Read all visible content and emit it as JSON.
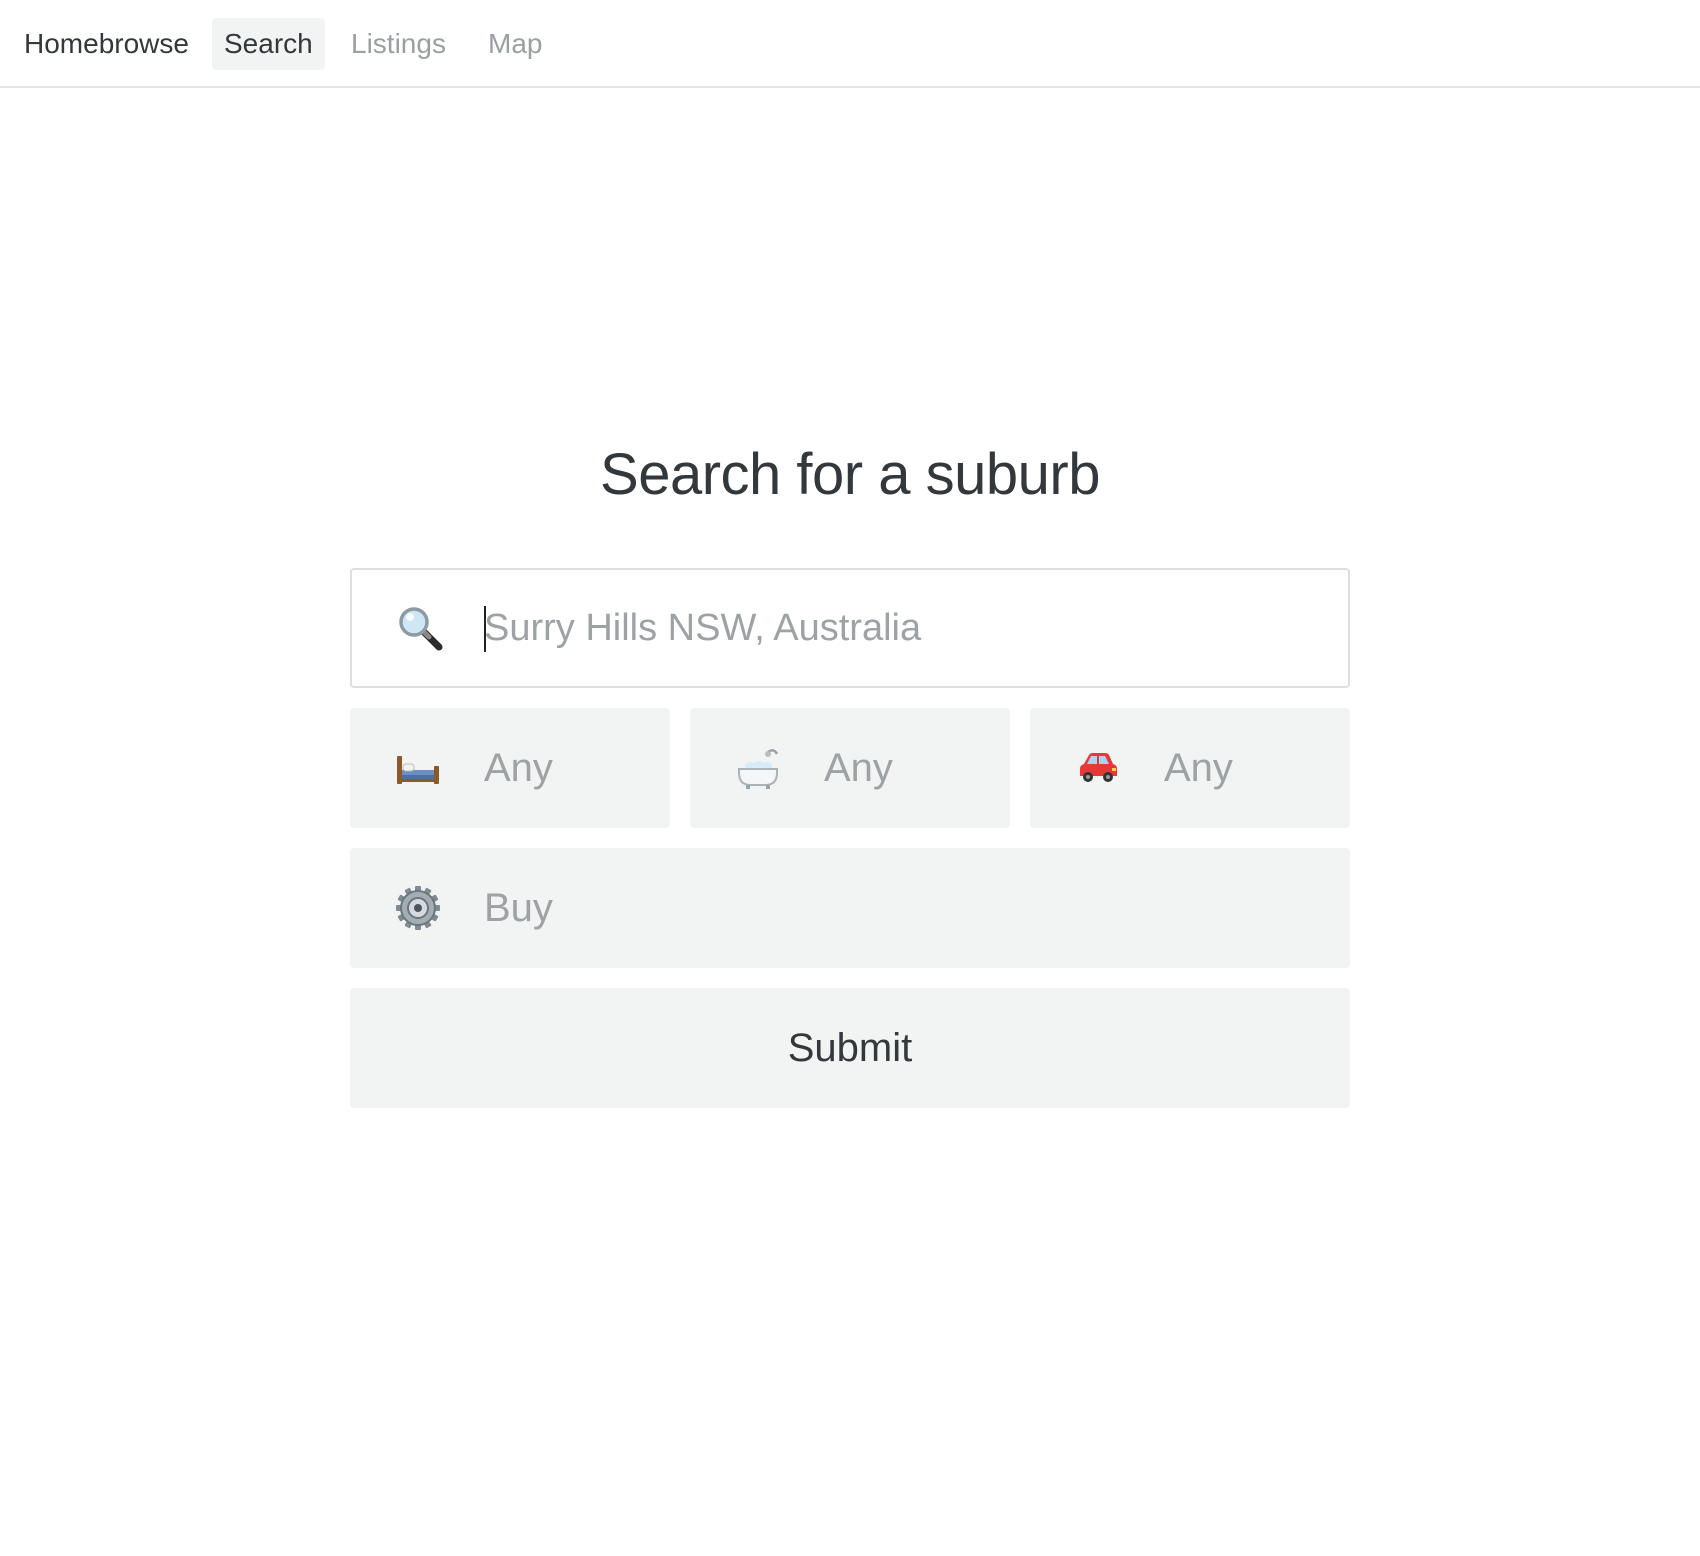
{
  "nav": {
    "brand": "Homebrowse",
    "items": [
      {
        "label": "Search",
        "active": true
      },
      {
        "label": "Listings",
        "active": false
      },
      {
        "label": "Map",
        "active": false
      }
    ]
  },
  "main": {
    "title": "Search for a suburb",
    "search": {
      "icon": "magnifier-icon",
      "placeholder": "Surry Hills NSW, Australia",
      "value": ""
    },
    "bedrooms": {
      "icon": "bed-icon",
      "value": "Any"
    },
    "bathrooms": {
      "icon": "bathtub-icon",
      "value": "Any"
    },
    "parking": {
      "icon": "car-icon",
      "value": "Any"
    },
    "listing_type": {
      "icon": "gear-icon",
      "value": "Buy"
    },
    "submit_label": "Submit"
  },
  "colors": {
    "text": "#33383d",
    "muted": "#9da2a5",
    "field_bg": "#f2f3f3",
    "border": "#dcdfe0",
    "car": "#e53935"
  }
}
